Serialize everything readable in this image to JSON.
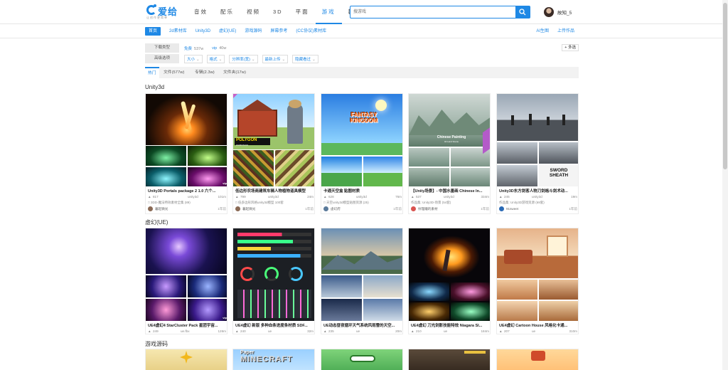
{
  "header": {
    "logo_name": "爱给",
    "logo_sub": "让创作更简单",
    "nav": [
      "音效",
      "配乐",
      "视频",
      "3D",
      "平面",
      "游戏",
      "教程"
    ],
    "active_nav": 5,
    "search_placeholder": "搜游戏",
    "username": "故知_5"
  },
  "subnav": {
    "items": [
      "首页",
      "2d素材库",
      "Unity3D",
      "虚幻(UE)",
      "游戏源码",
      "屏幕参考",
      "(CC协议)素材库"
    ],
    "right": [
      "AI生图",
      "上传作品"
    ]
  },
  "filters": {
    "row1": {
      "label": "下载类型",
      "options": [
        {
          "name": "免费",
          "count": "537w"
        },
        {
          "name": "vip",
          "count": "40w"
        }
      ]
    },
    "row2": {
      "label": "高级选项",
      "options": [
        "大小",
        "格式",
        "分辨率(宽)",
        "最新上传",
        "隐藏看过"
      ]
    },
    "multi": "+ 多选"
  },
  "tabs": [
    "热门",
    "文件(577w)",
    "专辑(2.3w)",
    "文件夹(17w)"
  ],
  "sections": [
    {
      "title": "Unity3d"
    },
    {
      "title": "虚幻(UE)"
    },
    {
      "title": "游戏源码"
    }
  ],
  "cards_row1": [
    {
      "title": "Unity3D Portals package 2 1.0 六个...",
      "views": "817",
      "tag": "unity3d",
      "size": "101m",
      "tagline": "□ 3DD-魔法特效素材全集 (89)",
      "author": "暮起微光",
      "time": "1年前"
    },
    {
      "title": "低边形农场商建筑车辆人物植物道具模型",
      "views": "799",
      "tag": "unity3d",
      "size": "24m",
      "tagline": "□ 低多边形风格unity3d模型 100套",
      "author": "暮起微光",
      "time": "1年前"
    },
    {
      "title": "卡通天空盒 贴图材质",
      "views": "628",
      "tag": "unity3d",
      "size": "76m",
      "tagline": "□ 天空unity3d模型贴图资源 (25)",
      "author": "虚幻府",
      "time": "1年前"
    },
    {
      "title": "【Unity场景】- 中国水墨画 Chinese In...",
      "views": "537",
      "tag": "unity3d",
      "size": "334m",
      "tagline": "作品集: Unity3D-场景 (54套)",
      "author": "纹理瞳的素材",
      "time": "1年前"
    },
    {
      "title": "Unity3D东方剑客人物刀剑格斗剑术动...",
      "views": "245",
      "tag": "unity3d",
      "size": "19m",
      "tagline": "作品集: Unity3D游戏资源 (69套)",
      "author": "91sweet",
      "time": "1年前"
    }
  ],
  "cards_row2": [
    {
      "title": "UE4虚幻4 StarCluster Pack 星团宇宙...",
      "views": "249",
      "tag": "ue.fbx",
      "size": "126m"
    },
    {
      "title": "UE4虚幻 新版 多种血条进度条材质 SDF...",
      "views": "240",
      "tag": "ue",
      "size": "32m"
    },
    {
      "title": "UE动态昼夜循环天气系统风雨雪的天空...",
      "views": "235",
      "tag": "ue",
      "size": "20m"
    },
    {
      "title": "UE4虚幻 刀光剑影技能特效 Niagara SI...",
      "views": "210",
      "tag": "ue",
      "size": "184m"
    },
    {
      "title": "UE4虚幻 Cartoon House 风格化卡通...",
      "views": "207",
      "tag": "ue",
      "size": "310m"
    }
  ],
  "badges": {
    "vip": "vip",
    "polygon": "POLYGON",
    "polygon_sub": "FARM PACK",
    "fantasy": "FANTASY KINGDOM",
    "chinese": "Chinese Painting",
    "chinese_sub": "3d Land Scene",
    "sword": "SWORD SHEATH",
    "paper": "Paper",
    "minecraft": "MINECRAFT"
  },
  "colors": {
    "accent": "#1e88e5"
  }
}
